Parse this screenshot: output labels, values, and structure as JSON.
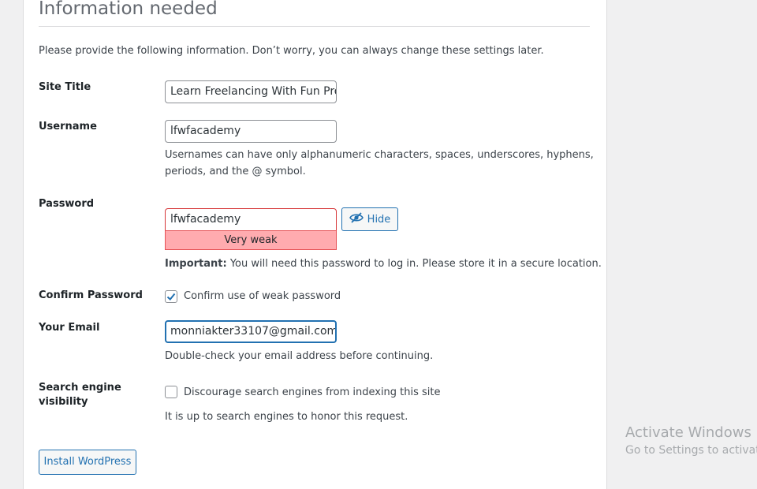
{
  "heading": "Information needed",
  "intro": "Please provide the following information. Don’t worry, you can always change these settings later.",
  "site_title": {
    "label": "Site Title",
    "value": "Learn Freelancing With Fun Pro"
  },
  "username": {
    "label": "Username",
    "value": "lfwfacademy",
    "hint_line1": "Usernames can have only alphanumeric characters, spaces, underscores, hyphens,",
    "hint_line2": "periods, and the @ symbol."
  },
  "password": {
    "label": "Password",
    "value": "lfwfacademy",
    "strength": "Very weak",
    "hide_label": "Hide",
    "important_bold": "Important:",
    "important_text": " You will need this password to log in. Please store it in a secure location."
  },
  "confirm_password": {
    "label": "Confirm Password",
    "checkbox_label": "Confirm use of weak password",
    "checked": true
  },
  "email": {
    "label": "Your Email",
    "value": "monniakter33107@gmail.com",
    "hint": "Double-check your email address before continuing."
  },
  "search_engine": {
    "label_line1": "Search engine",
    "label_line2": "visibility",
    "checkbox_label": "Discourage search engines from indexing this site",
    "checked": false,
    "hint": "It is up to search engines to honor this request."
  },
  "install_button": "Install WordPress",
  "watermark": {
    "line1": "Activate Windows",
    "line2": "Go to Settings to activate"
  },
  "colors": {
    "accent": "#2271b1",
    "weak_bg": "#ffabaf",
    "weak_border": "#d63638"
  }
}
